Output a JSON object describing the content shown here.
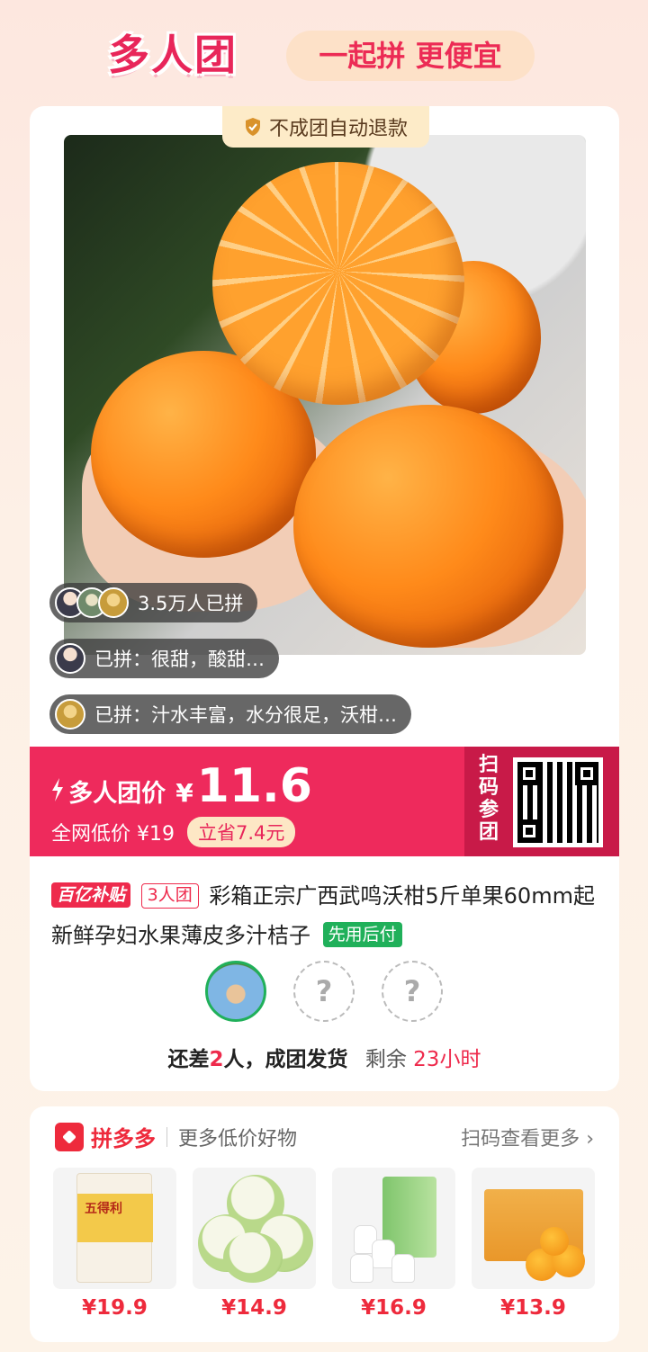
{
  "header": {
    "title": "多人团",
    "slogan": "一起拼 更便宜"
  },
  "card": {
    "refund_notice": "不成团自动退款",
    "joined_count": "3.5万人已拼",
    "comments": [
      "已拼：很甜，酸甜…",
      "已拼：汁水丰富，水分很足，沃柑…"
    ]
  },
  "price": {
    "label": "多人团价",
    "currency": "¥",
    "value": "11.6",
    "market_price": "全网低价 ¥19",
    "save": "立省7.4元",
    "scan_label": "扫码参团"
  },
  "product": {
    "tag_subsidy": "百亿补贴",
    "tag_group": "3人团",
    "title": "彩箱正宗广西武鸣沃柑5斤单果60mm起新鲜孕妇水果薄皮多汁桔子",
    "tag_pay": "先用后付"
  },
  "group": {
    "empty_slot_mark": "?",
    "status_prefix": "还差",
    "status_count": "2",
    "status_suffix": "人，成团发货",
    "remain_label": "剩余",
    "remain_time": "23小时"
  },
  "recommend": {
    "brand": "拼多多",
    "subtitle": "更多低价好物",
    "more": "扫码查看更多",
    "items": [
      {
        "price": "¥19.9",
        "brand_text": "五得利"
      },
      {
        "price": "¥14.9"
      },
      {
        "price": "¥16.9"
      },
      {
        "price": "¥13.9"
      }
    ]
  },
  "colors": {
    "accent": "#ee2a5c",
    "accent_dark": "#c81a48",
    "success": "#20b05a"
  }
}
